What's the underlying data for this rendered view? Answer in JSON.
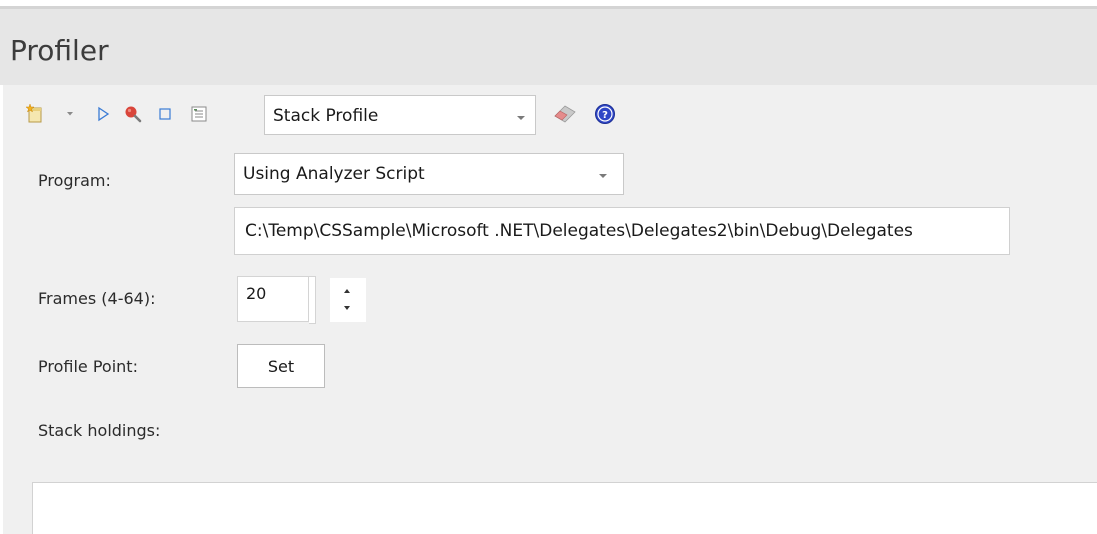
{
  "window": {
    "title": "Profiler"
  },
  "toolbar": {
    "buttons": [
      {
        "name": "new-icon",
        "label": ""
      },
      {
        "name": "dropdown-arrow-icon",
        "label": ""
      },
      {
        "name": "play-icon",
        "label": ""
      },
      {
        "name": "search-icon",
        "label": ""
      },
      {
        "name": "stop-icon",
        "label": ""
      },
      {
        "name": "report-icon",
        "label": ""
      }
    ],
    "mode_select": {
      "selected": "Stack Profile"
    },
    "erase_icon": "eraser-icon",
    "help_icon": "help-icon"
  },
  "form": {
    "program": {
      "label": "Program:",
      "selected": "Using Analyzer Script",
      "path": "C:\\Temp\\CSSample\\Microsoft .NET\\Delegates\\Delegates2\\bin\\Debug\\Delegates"
    },
    "frames": {
      "label": "Frames (4-64):",
      "value": "20"
    },
    "profile_point": {
      "label": "Profile Point:",
      "button_label": "Set"
    },
    "stack_holdings": {
      "label": "Stack holdings:"
    }
  },
  "colors": {
    "header_bg": "#e6e6e6",
    "body_bg": "#f0f0f0",
    "play_blue": "#3a7bd5",
    "search_red": "#d9453a",
    "help_blue": "#2f46c6"
  }
}
